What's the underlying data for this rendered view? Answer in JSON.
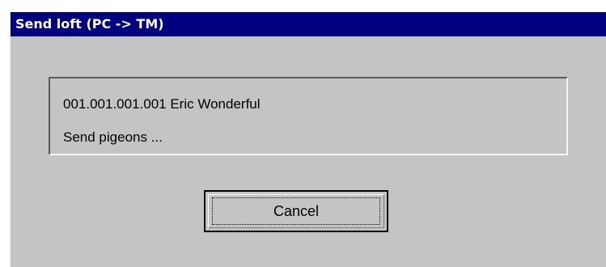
{
  "window": {
    "title": "Send loft (PC -> TM)"
  },
  "status": {
    "line1": "001.001.001.001 Eric Wonderful",
    "line2": "Send pigeons ..."
  },
  "buttons": {
    "cancel_label": "Cancel"
  },
  "colors": {
    "titlebar": "#000080",
    "dialog_face": "#c4c4c4",
    "title_text": "#ffffff"
  }
}
